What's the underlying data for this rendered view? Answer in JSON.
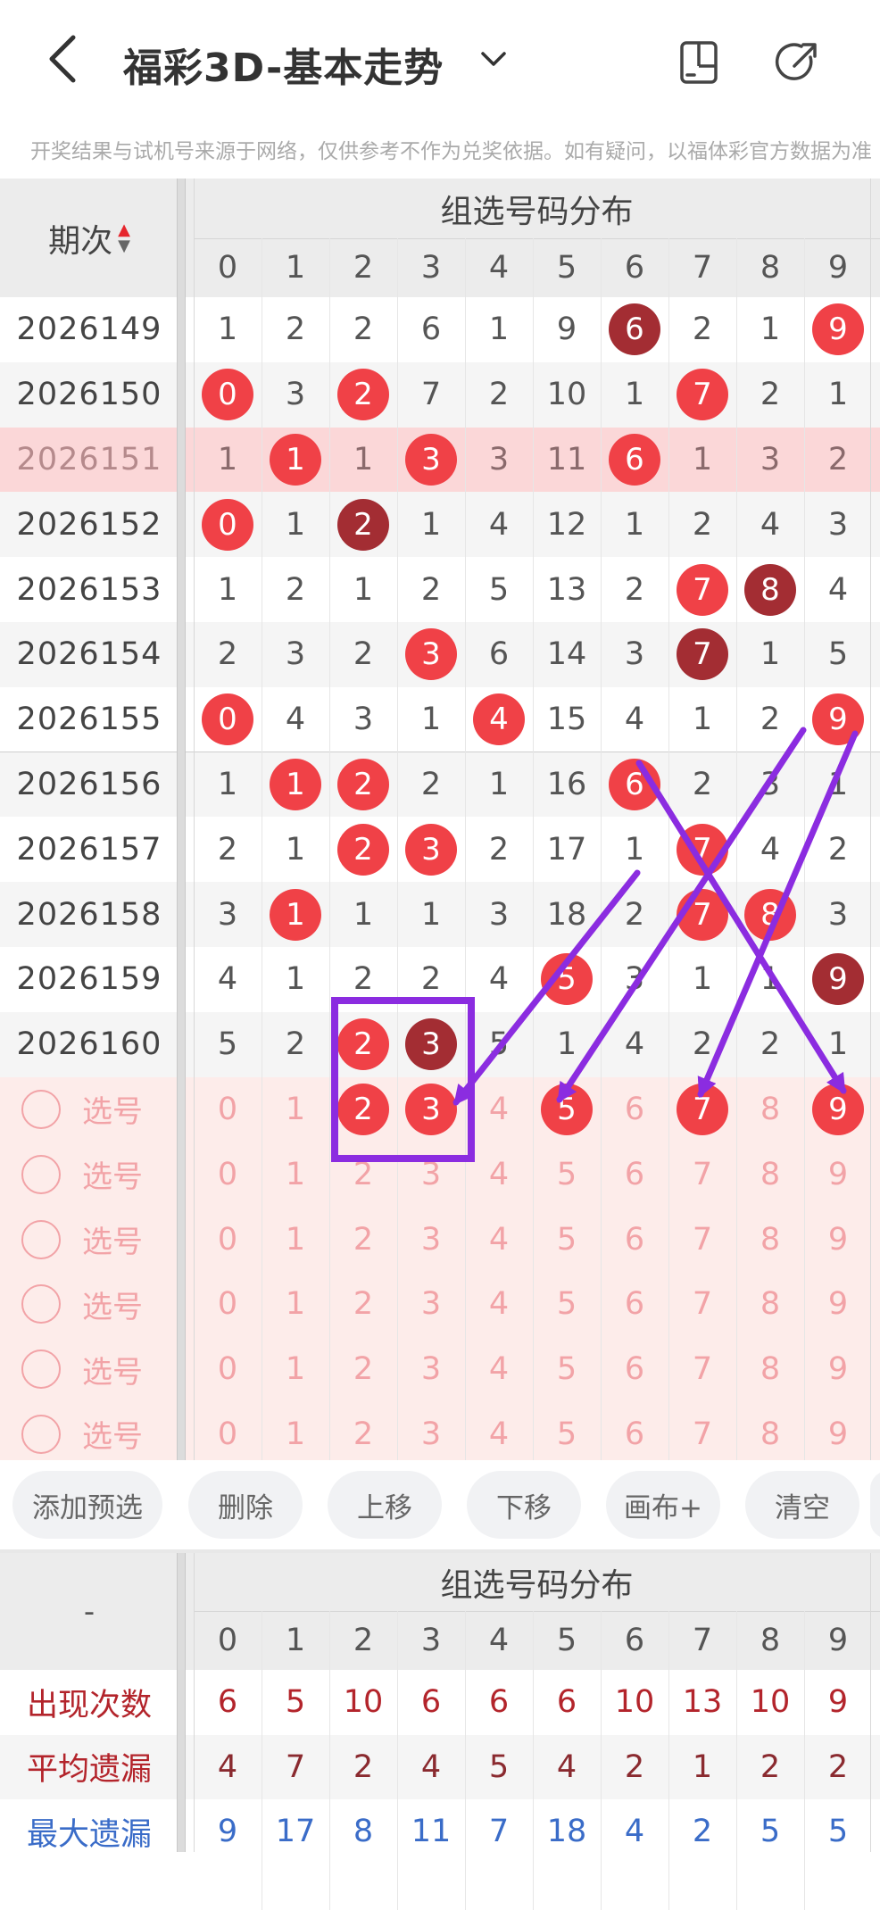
{
  "header": {
    "title": "福彩3D-基本走势",
    "notice": "开奖结果与试机号来源于网络，仅供参考不作为兑奖依据。如有疑问，以福体彩官方数据为准"
  },
  "table": {
    "period_header": "期次",
    "group_header": "组选号码分布",
    "digits": [
      "0",
      "1",
      "2",
      "3",
      "4",
      "5",
      "6",
      "7",
      "8",
      "9"
    ],
    "rows": [
      {
        "period": "2026149",
        "cells": [
          "1",
          "2",
          "2",
          "6",
          "1",
          "9",
          "6",
          "2",
          "1",
          "9"
        ],
        "balls": {
          "6": "dark",
          "9": "red"
        }
      },
      {
        "period": "2026150",
        "cells": [
          "0",
          "3",
          "2",
          "7",
          "2",
          "10",
          "1",
          "7",
          "2",
          "1"
        ],
        "balls": {
          "0": "red",
          "2": "red",
          "7": "red"
        }
      },
      {
        "period": "2026151",
        "cells": [
          "1",
          "1",
          "1",
          "3",
          "3",
          "11",
          "6",
          "1",
          "3",
          "2"
        ],
        "balls": {
          "1": "red",
          "3": "red",
          "6": "red"
        }
      },
      {
        "period": "2026152",
        "cells": [
          "0",
          "1",
          "2",
          "1",
          "4",
          "12",
          "1",
          "2",
          "4",
          "3"
        ],
        "balls": {
          "0": "red",
          "2": "dark"
        }
      },
      {
        "period": "2026153",
        "cells": [
          "1",
          "2",
          "1",
          "2",
          "5",
          "13",
          "2",
          "7",
          "8",
          "4"
        ],
        "balls": {
          "7": "red",
          "8": "dark"
        }
      },
      {
        "period": "2026154",
        "cells": [
          "2",
          "3",
          "2",
          "3",
          "6",
          "14",
          "3",
          "7",
          "1",
          "5"
        ],
        "balls": {
          "3": "red",
          "7": "dark"
        }
      },
      {
        "period": "2026155",
        "cells": [
          "0",
          "4",
          "3",
          "1",
          "4",
          "15",
          "4",
          "1",
          "2",
          "9"
        ],
        "balls": {
          "0": "red",
          "4": "red",
          "9": "red"
        }
      },
      {
        "period": "2026156",
        "cells": [
          "1",
          "1",
          "2",
          "2",
          "1",
          "16",
          "6",
          "2",
          "3",
          "1"
        ],
        "balls": {
          "1": "red",
          "2": "red",
          "6": "red"
        }
      },
      {
        "period": "2026157",
        "cells": [
          "2",
          "1",
          "2",
          "3",
          "2",
          "17",
          "1",
          "7",
          "4",
          "2"
        ],
        "balls": {
          "2": "red",
          "3": "red",
          "7": "red"
        }
      },
      {
        "period": "2026158",
        "cells": [
          "3",
          "1",
          "1",
          "1",
          "3",
          "18",
          "2",
          "7",
          "8",
          "3"
        ],
        "balls": {
          "1": "red",
          "7": "red",
          "8": "red"
        }
      },
      {
        "period": "2026159",
        "cells": [
          "4",
          "1",
          "2",
          "2",
          "4",
          "5",
          "3",
          "1",
          "1",
          "9"
        ],
        "balls": {
          "5": "red",
          "9": "dark"
        }
      },
      {
        "period": "2026160",
        "cells": [
          "5",
          "2",
          "2",
          "3",
          "5",
          "1",
          "4",
          "2",
          "2",
          "1"
        ],
        "balls": {
          "2": "red",
          "3": "dark"
        }
      }
    ],
    "select_label": "选号",
    "select_rows": [
      {
        "balls": {
          "2": "red",
          "3": "red",
          "5": "red",
          "7": "red",
          "9": "red"
        }
      },
      {
        "balls": {}
      },
      {
        "balls": {}
      },
      {
        "balls": {}
      },
      {
        "balls": {}
      },
      {
        "balls": {}
      }
    ]
  },
  "buttons": [
    "添加预选",
    "删除",
    "上移",
    "下移",
    "画布+",
    "清空"
  ],
  "stats": {
    "dash": "-",
    "group_header": "组选号码分布",
    "rows": [
      {
        "label": "出现次数",
        "values": [
          "6",
          "5",
          "10",
          "6",
          "6",
          "6",
          "10",
          "13",
          "10",
          "9"
        ]
      },
      {
        "label": "平均遗漏",
        "values": [
          "4",
          "7",
          "2",
          "4",
          "5",
          "4",
          "2",
          "1",
          "2",
          "2"
        ]
      },
      {
        "label": "最大遗漏",
        "values": [
          "9",
          "17",
          "8",
          "11",
          "7",
          "18",
          "4",
          "2",
          "5",
          "5"
        ]
      }
    ]
  },
  "colors": {
    "ball_red": "#f04147",
    "ball_dark": "#a32d33",
    "annotation": "#8b2ce0",
    "highlight_row": "#fbd7d8",
    "select_bg": "#fdecea"
  },
  "icons": [
    "back-arrow-icon",
    "chevron-down-icon",
    "device-icon",
    "share-icon",
    "circle-select-icon",
    "sort-arrows-icon"
  ]
}
